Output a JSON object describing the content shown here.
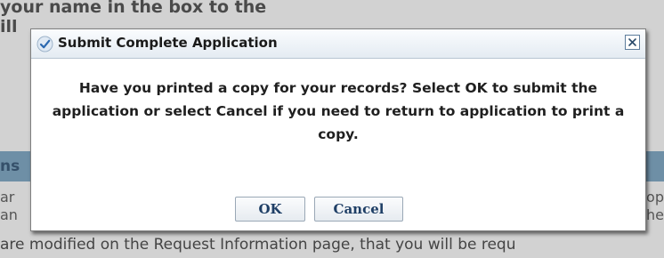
{
  "background": {
    "top_line": "your name in the box to the",
    "frag_ill": "ill",
    "section_frag": "ns",
    "left_frags": [
      "ar",
      "an"
    ],
    "right_frags": [
      "op",
      "he"
    ],
    "bottom_line": "are modified on the Request Information page, that you will be requ"
  },
  "dialog": {
    "title": "Submit Complete Application",
    "message": "Have you printed a copy for your records? Select OK to submit the application or select Cancel if you need to return to application to print a copy.",
    "ok_label": "OK",
    "cancel_label": "Cancel",
    "close_icon": "close-icon",
    "title_icon": "check-icon"
  },
  "colors": {
    "title_bar": "#e9eff5",
    "button_text": "#1f3f66",
    "section_band": "#6e8fa6"
  }
}
